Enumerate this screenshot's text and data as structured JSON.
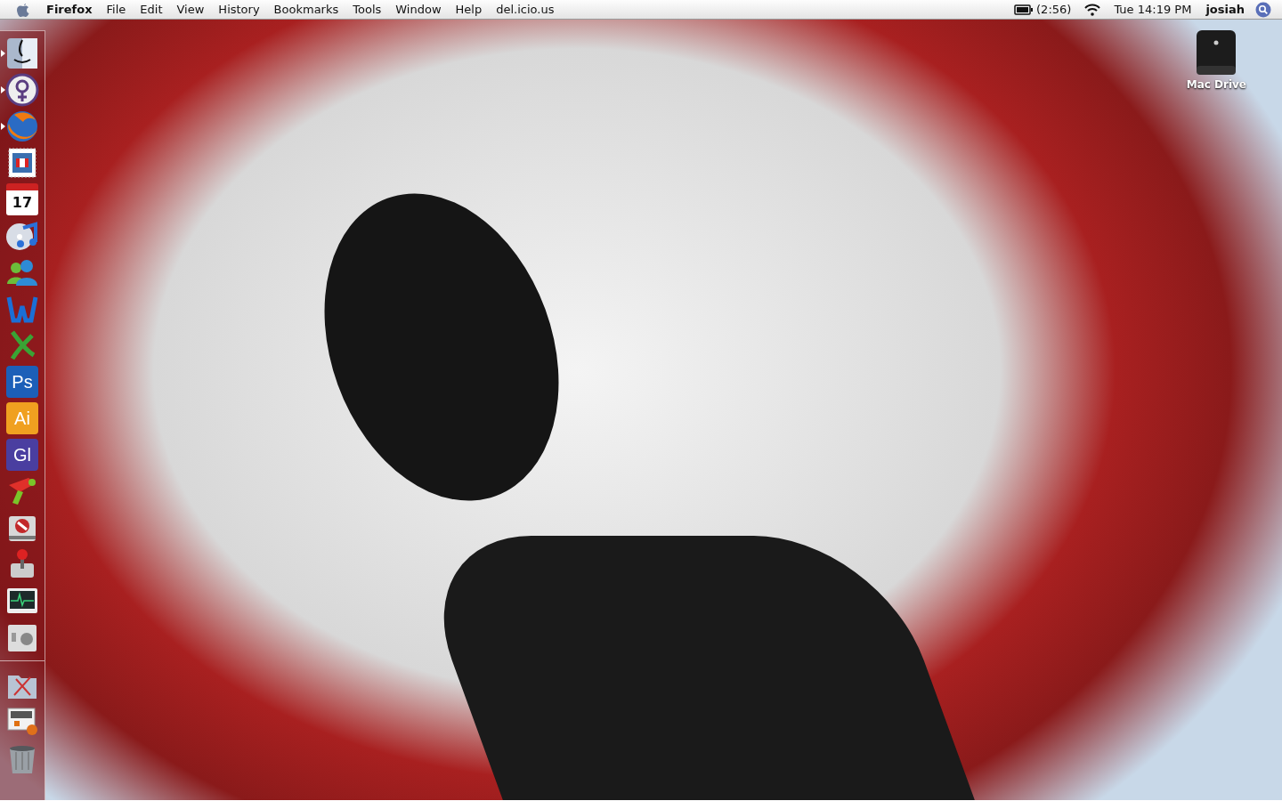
{
  "menu_bar": {
    "app_name": "Firefox",
    "menus": [
      "File",
      "Edit",
      "View",
      "History",
      "Bookmarks",
      "Tools",
      "Window",
      "Help",
      "del.icio.us"
    ],
    "battery": {
      "reading": "(2:56)"
    },
    "clock": "Tue 14:19 PM",
    "user": "josiah"
  },
  "desktop_icons": [
    {
      "label": "Mac Drive",
      "kind": "drive"
    }
  ],
  "dock": {
    "apps": [
      {
        "kind": "finder",
        "running": true
      },
      {
        "kind": "venus",
        "running": true
      },
      {
        "kind": "firefox",
        "running": true
      },
      {
        "kind": "stamp",
        "running": false
      },
      {
        "kind": "calendar",
        "text": "17",
        "running": false
      },
      {
        "kind": "music",
        "running": false
      },
      {
        "kind": "people",
        "running": false
      },
      {
        "kind": "word",
        "running": false
      },
      {
        "kind": "excel",
        "running": false
      },
      {
        "kind": "tile",
        "text": "Ps",
        "color": "#1c5fb8",
        "running": false
      },
      {
        "kind": "tile",
        "text": "Ai",
        "color": "#f0a020",
        "running": false
      },
      {
        "kind": "tile",
        "text": "Gl",
        "color": "#4a3ea0",
        "running": false
      },
      {
        "kind": "raygun",
        "running": false
      },
      {
        "kind": "disk",
        "running": false
      },
      {
        "kind": "joystick",
        "running": false
      },
      {
        "kind": "monitor",
        "running": false
      },
      {
        "kind": "switch",
        "running": false
      }
    ],
    "others": [
      {
        "kind": "folder"
      },
      {
        "kind": "document"
      },
      {
        "kind": "trash"
      }
    ]
  }
}
